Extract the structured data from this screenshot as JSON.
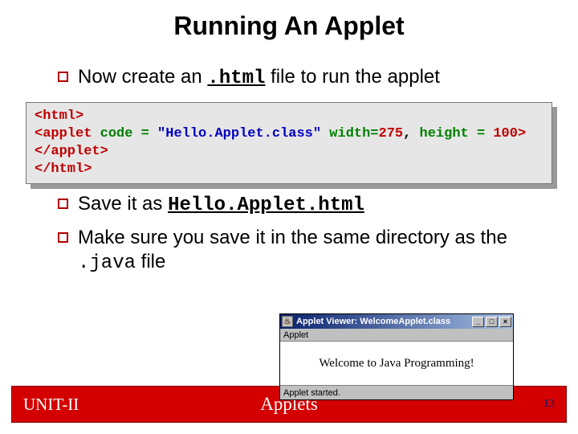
{
  "title": "Running An Applet",
  "bullets": {
    "b1_pre": "Now create an ",
    "b1_code": ".html",
    "b1_post": " file to run the applet",
    "b2_pre": "Save it as ",
    "b2_code": "Hello.Applet.html",
    "b3_pre": "Make sure you save it in the same directory as the ",
    "b3_code": ".java",
    "b3_post": " file"
  },
  "code": {
    "l1_a": "<html>",
    "l2_a": "<applet",
    "l2_b": " code = ",
    "l2_c": "\"Hello.Applet.class\"",
    "l2_d": " width=",
    "l2_e": "275",
    "l2_f": ", ",
    "l2_g": "height = ",
    "l2_h": "100",
    "l2_i": ">",
    "l3_a": "</applet>",
    "l4_a": "</html>"
  },
  "appwin": {
    "title": "Applet Viewer: WelcomeApplet.class",
    "menu": "Applet",
    "body": "Welcome to Java Programming!",
    "status": "Applet started.",
    "min": "_",
    "max": "□",
    "close": "×"
  },
  "footer": {
    "left": "UNIT-II",
    "center": "Applets",
    "right": "13"
  }
}
